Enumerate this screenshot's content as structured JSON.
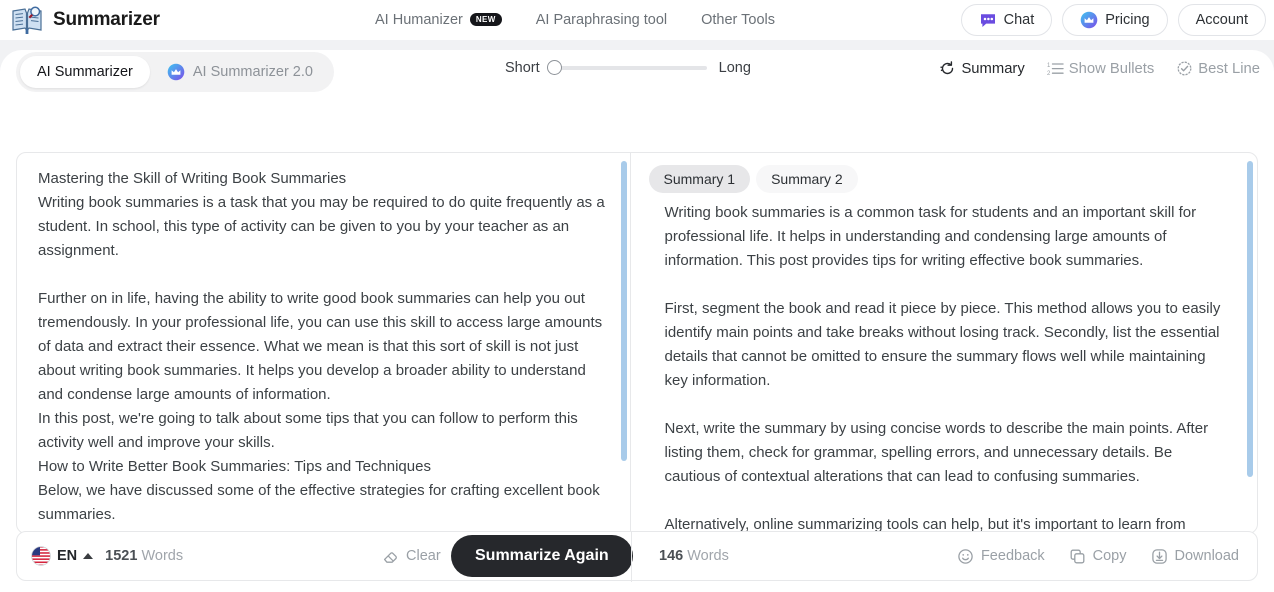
{
  "header": {
    "logo_icon": "book-search-icon",
    "title": "Summarizer",
    "nav": [
      {
        "label": "AI Humanizer",
        "badge": "NEW"
      },
      {
        "label": "AI Paraphrasing tool",
        "badge": ""
      },
      {
        "label": "Other Tools",
        "badge": ""
      }
    ],
    "actions": [
      {
        "label": "Chat",
        "icon": "chat-bubble-icon"
      },
      {
        "label": "Pricing",
        "icon": "crown-icon"
      },
      {
        "label": "Account",
        "icon": ""
      }
    ]
  },
  "toolbar": {
    "segments": [
      {
        "label": "AI Summarizer",
        "active": true,
        "icon": ""
      },
      {
        "label": "AI Summarizer 2.0",
        "active": false,
        "icon": "crown-icon"
      }
    ],
    "slider": {
      "min_label": "Short",
      "max_label": "Long",
      "value_percent": 0
    },
    "modes": [
      {
        "label": "Summary",
        "icon": "refresh-icon",
        "active": true
      },
      {
        "label": "Show Bullets",
        "icon": "numbered-list-icon",
        "active": false
      },
      {
        "label": "Best Line",
        "icon": "check-badge-icon",
        "active": false
      }
    ]
  },
  "editor": {
    "source_text": "Mastering the Skill of Writing Book Summaries\nWriting book summaries is a task that you may be required to do quite frequently as a student. In school, this type of activity can be given to you by your teacher as an assignment.\n\nFurther on in life, having the ability to write good book summaries can help you out tremendously. In your professional life, you can use this skill to access large amounts of data and extract their essence. What we mean is that this sort of skill is not just about writing book summaries. It helps you develop a broader ability to understand and condense large amounts of information.\nIn this post, we're going to talk about some tips that you can follow to perform this activity well and improve your skills.\nHow to Write Better Book Summaries: Tips and Techniques\nBelow, we have discussed some of the effective strategies for crafting excellent book summaries.",
    "summary_tabs": [
      {
        "label": "Summary 1",
        "active": true
      },
      {
        "label": "Summary 2",
        "active": false
      }
    ],
    "summary_text": "Writing book summaries is a common task for students and an important skill for professional life. It helps in understanding and condensing large amounts of information. This post provides tips for writing effective book summaries.\n\nFirst, segment the book and read it piece by piece. This method allows you to easily identify main points and take breaks without losing track. Secondly, list the essential details that cannot be omitted to ensure the summary flows well while maintaining key information.\n\nNext, write the summary by using concise words to describe the main points. After listing them, check for grammar, spelling errors, and unnecessary details. Be cautious of contextual alterations that can lead to confusing summaries.\n\nAlternatively, online summarizing tools can help, but it's important to learn from"
  },
  "footer": {
    "language": {
      "code": "EN",
      "flag_icon": "us-flag-icon",
      "caret": "caret-up-icon"
    },
    "source_word_count_number": "1521",
    "source_word_count_unit": "Words",
    "clear_label": "Clear",
    "clear_icon": "eraser-icon",
    "primary_button": "Summarize Again",
    "result_word_count_number": "146",
    "result_word_count_unit": "Words",
    "actions": [
      {
        "label": "Feedback",
        "icon": "smiley-icon"
      },
      {
        "label": "Copy",
        "icon": "copy-icon"
      },
      {
        "label": "Download",
        "icon": "download-icon"
      }
    ]
  },
  "colors": {
    "accent_dark": "#26282c",
    "scrollbar": "#a8cbea",
    "page_bg": "#f1f2f4"
  }
}
